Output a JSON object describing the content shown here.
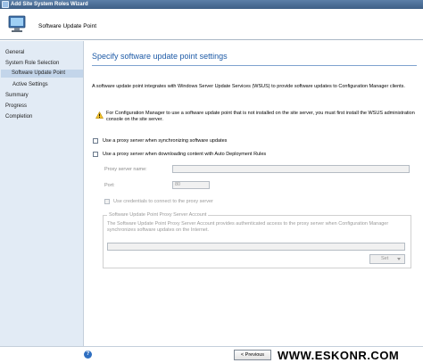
{
  "window": {
    "title": "Add Site System Roles Wizard"
  },
  "header": {
    "title": "Software Update Point"
  },
  "sidebar": {
    "items": [
      {
        "label": "General"
      },
      {
        "label": "System Role Selection"
      },
      {
        "label": "Software Update Point",
        "active": true
      },
      {
        "label": "Active Settings"
      },
      {
        "label": "Summary"
      },
      {
        "label": "Progress"
      },
      {
        "label": "Completion"
      }
    ]
  },
  "main": {
    "section_title": "Specify software update point settings",
    "intro": "A software update point integrates with Windows Server Update Services (WSUS) to provide software updates to Configuration Manager clients.",
    "warning": "For Configuration Manager to use a software update point that is not installed on the site server, you must first install the WSUS administration console on the site server.",
    "proxy_sync": {
      "label": "Use a proxy server when synchronizing software updates",
      "checked": false
    },
    "proxy_adr": {
      "label": "Use a proxy server when downloading content with Auto Deployment Rules",
      "checked": false
    },
    "proxy_server_name": {
      "label": "Proxy server name:",
      "value": ""
    },
    "port": {
      "label": "Port:",
      "value": "80"
    },
    "use_credentials": {
      "label": "Use credentials to connect to the proxy server",
      "checked": false
    },
    "account_group": {
      "title": "Software Update Point Proxy Server Account",
      "description": "The Software Update Point Proxy Server Account provides authenticated access to the proxy server when Configuration Manager synchronizes software updates on the Internet.",
      "account_value": "",
      "set_label": "Set"
    }
  },
  "footer": {
    "help_glyph": "?",
    "previous_label": "< Previous",
    "watermark": "WWW.ESKONR.COM"
  }
}
